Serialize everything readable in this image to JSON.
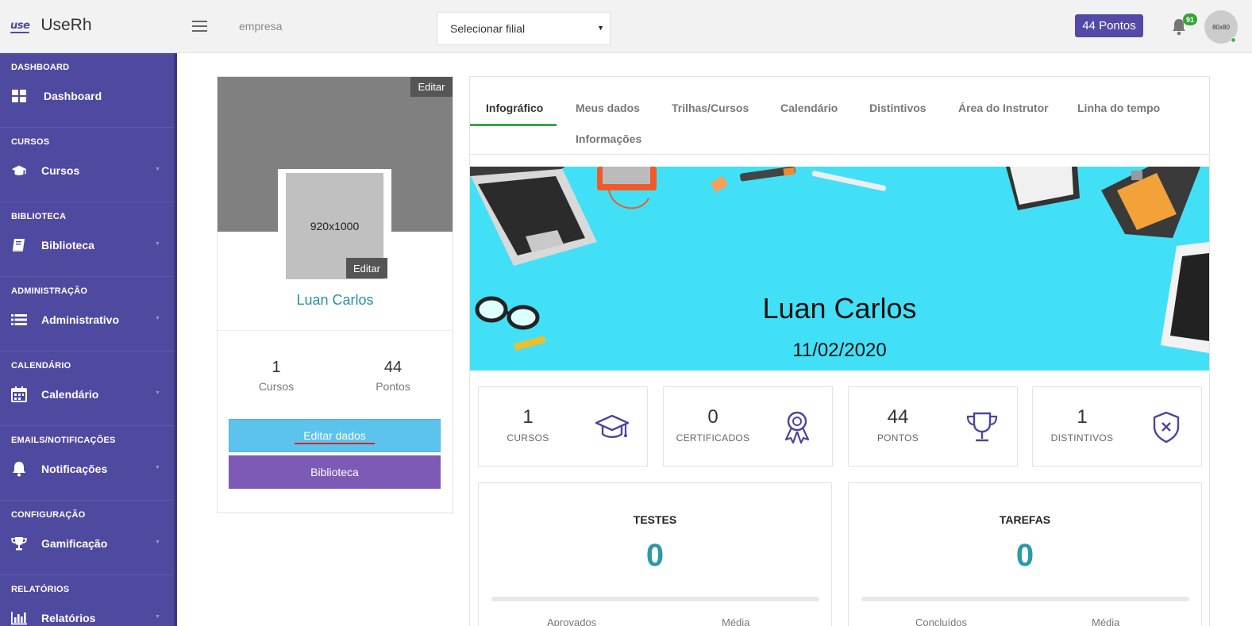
{
  "topbar": {
    "logo_text": "use",
    "app_name": "UseRh",
    "company": "empresa",
    "branch_select": "Selecionar filial",
    "points_badge": "44 Pontos",
    "notifications_count": "91",
    "avatar_text": "80x80"
  },
  "sidebar": {
    "sections": [
      {
        "heading": "DASHBOARD",
        "label": "Dashboard",
        "icon": "grid-icon"
      },
      {
        "heading": "CURSOS",
        "label": "Cursos",
        "icon": "graduation-cap-icon"
      },
      {
        "heading": "BIBLIOTECA",
        "label": "Biblioteca",
        "icon": "book-icon"
      },
      {
        "heading": "ADMINISTRAÇÃO",
        "label": "Administrativo",
        "icon": "list-icon"
      },
      {
        "heading": "CALENDÁRIO",
        "label": "Calendário",
        "icon": "calendar-icon"
      },
      {
        "heading": "EMAILS/NOTIFICAÇÕES",
        "label": "Notificações",
        "icon": "bell-icon"
      },
      {
        "heading": "CONFIGURAÇÃO",
        "label": "Gamificação",
        "icon": "trophy-icon"
      },
      {
        "heading": "RELATÓRIOS",
        "label": "Relatórios",
        "icon": "bar-chart-icon"
      }
    ]
  },
  "profile": {
    "edit_cover": "Editar",
    "photo_placeholder": "920x1000",
    "edit_photo": "Editar",
    "name": "Luan Carlos",
    "stats": [
      {
        "value": "1",
        "label": "Cursos"
      },
      {
        "value": "44",
        "label": "Pontos"
      }
    ],
    "edit_button": "Editar dados",
    "library_button": "Biblioteca"
  },
  "tabs": [
    {
      "label": "Infográfico",
      "active": true
    },
    {
      "label": "Meus dados"
    },
    {
      "label": "Trilhas/Cursos"
    },
    {
      "label": "Calendário"
    },
    {
      "label": "Distintivos"
    },
    {
      "label": "Área do Instrutor"
    },
    {
      "label": "Linha do tempo"
    },
    {
      "label": "Informações"
    }
  ],
  "banner": {
    "name": "Luan Carlos",
    "date": "11/02/2020",
    "background": "#42e0f7"
  },
  "metrics": [
    {
      "value": "1",
      "label": "CURSOS",
      "icon": "graduation-cap-icon"
    },
    {
      "value": "0",
      "label": "CERTIFICADOS",
      "icon": "award-ribbon-icon"
    },
    {
      "value": "44",
      "label": "PONTOS",
      "icon": "trophy-icon"
    },
    {
      "value": "1",
      "label": "DISTINTIVOS",
      "icon": "shield-x-icon"
    }
  ],
  "boxes": [
    {
      "title": "TESTES",
      "value": "0",
      "sub_left": "Aprovados",
      "sub_right": "Média"
    },
    {
      "title": "TAREFAS",
      "value": "0",
      "sub_left": "Concluídos",
      "sub_right": "Média"
    }
  ],
  "colors": {
    "sidebar": "#5049a0",
    "accent": "#524aa6",
    "teal": "#2a9aa8",
    "edit_button": "#5cc3ec",
    "library_button": "#7d5ab5"
  }
}
